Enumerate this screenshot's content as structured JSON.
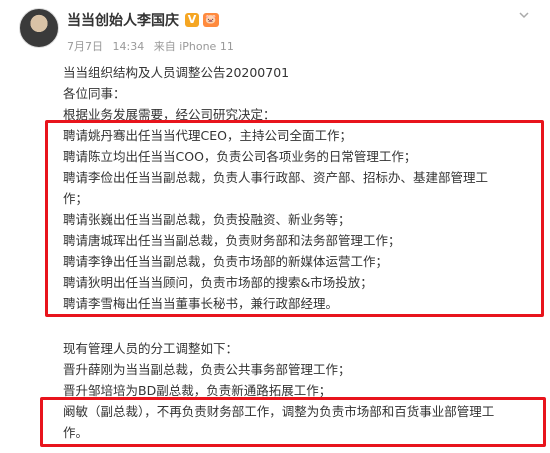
{
  "post": {
    "username": "当当创始人李国庆",
    "verified_badge": "V",
    "level_badge": "🐷",
    "date": "7月7日",
    "time": "14:34",
    "source": "来自 iPhone 11",
    "menu_icon": "chevron-down-icon"
  },
  "body": {
    "title": "当当组织结构及人员调整公告20200701",
    "greeting": "各位同事：",
    "intro": "根据业务发展需要，经公司研究决定：",
    "appointments": [
      "聘请姚丹骞出任当当代理CEO，主持公司全面工作；",
      "聘请陈立均出任当当COO，负责公司各项业务的日常管理工作；",
      "聘请李俭出任当当副总裁，负责人事行政部、资产部、招标办、基建部管理工",
      "作；",
      "聘请张巍出任当当副总裁，负责投融资、新业务等；",
      "聘请唐城珲出任当当副总裁，负责财务部和法务部管理工作；",
      "聘请李铮出任当当副总裁，负责市场部的新媒体运营工作；",
      "聘请狄明出任当当顾问，负责市场部的搜索&市场投放；",
      "聘请李雪梅出任当当董事长秘书，兼行政部经理。"
    ],
    "adjust_title": "现有管理人员的分工调整如下：",
    "adjustments": [
      "晋升薛刚为当当副总裁，负责公共事务部管理工作；",
      "晋升邹培培为BD副总裁，负责新通路拓展工作；"
    ],
    "highlight": [
      "阚敏（副总裁），不再负责财务部工作，调整为负责市场部和百货事业部管理工",
      "作。"
    ]
  },
  "colors": {
    "highlight_box": "#e8141c",
    "text": "#333333",
    "meta": "#999999"
  }
}
